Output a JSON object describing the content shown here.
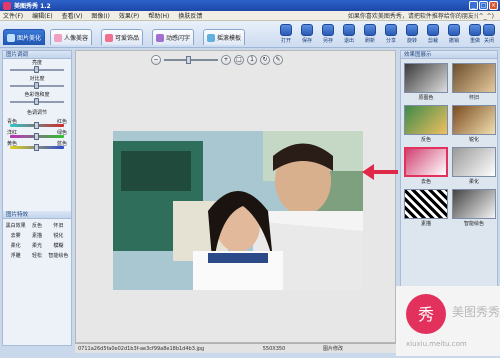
{
  "window": {
    "title": "美图秀秀 1.2"
  },
  "menu": [
    "文件(F)",
    "编辑(E)",
    "查看(V)",
    "图像(I)",
    "效果(P)",
    "帮助(H)",
    "换肤反馈"
  ],
  "marquee": "如果你喜欢美图秀秀，请把软件推荐给你的朋友!(^_^)",
  "tabs": [
    {
      "label": "图片美化",
      "color": "#7fb0f0"
    },
    {
      "label": "人像美容",
      "color": "#f0a0c0"
    },
    {
      "label": "可爱饰品",
      "color": "#f07090"
    },
    {
      "label": "动感闪字",
      "color": "#a070d0"
    },
    {
      "label": "摇滚模板",
      "color": "#60b0e0"
    }
  ],
  "toolbar": [
    "打开",
    "保存",
    "另存",
    "退出",
    "刷新",
    "分享",
    "旋转",
    "剪裁",
    "撤销",
    "重做",
    "关闭"
  ],
  "left": {
    "title": "图片调调",
    "sliders": [
      "亮度",
      "对比度",
      "色彩饱和度"
    ],
    "color_title": "色调调节",
    "colors": [
      {
        "l": "青色",
        "r": "红色",
        "c": "linear-gradient(90deg,#2ec6c6,#d02a2a)"
      },
      {
        "l": "洋红",
        "r": "绿色",
        "c": "linear-gradient(90deg,#c22ec2,#2ec22e)"
      },
      {
        "l": "黄色",
        "r": "蓝色",
        "c": "linear-gradient(90deg,#e0d020,#2a4ad0)"
      }
    ]
  },
  "effects": {
    "title": "图片特效",
    "items": [
      "黑白效果",
      "反色",
      "怀旧",
      "去雾",
      "素描",
      "锐化",
      "柔化",
      "柔光",
      "模糊",
      "浮雕",
      "轻松",
      "智能绘色"
    ]
  },
  "right": {
    "title": "效果图展示",
    "thumbs": [
      "原图色",
      "怀旧",
      "反色",
      "锐化",
      "去色",
      "柔化",
      "素描",
      "智能绘色"
    ]
  },
  "status": {
    "file": "0711a26d5fa0e02d1b3f-ae3cf99a8e18b1d4b3.jpg",
    "size": "550X350",
    "hint": "图片修改"
  },
  "logo": {
    "name": "美图秀秀",
    "url": "xiuxiu.meitu.com",
    "seal": "秀"
  }
}
